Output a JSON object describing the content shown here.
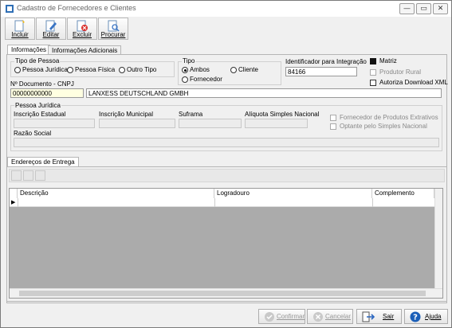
{
  "window": {
    "title": "Cadastro de Fornecedores e Clientes",
    "min": "—",
    "max": "▭",
    "close": "✕"
  },
  "toolbar": [
    {
      "label": "Incluir",
      "icon": "new-document-icon"
    },
    {
      "label": "Editar",
      "icon": "edit-icon"
    },
    {
      "label": "Excluir",
      "icon": "delete-icon"
    },
    {
      "label": "Procurar",
      "icon": "search-document-icon"
    }
  ],
  "tabs": {
    "info": "Informações",
    "extra": "Informações Adicionais"
  },
  "tipo_pessoa": {
    "label": "Tipo de Pessoa",
    "options": [
      "Pessoa Jurídica",
      "Pessoa Física",
      "Outro Tipo"
    ]
  },
  "tipo": {
    "label": "Tipo",
    "options": [
      "Ambos",
      "Cliente",
      "Fornecedor"
    ],
    "selected": "Ambos"
  },
  "integracao": {
    "label": "Identificador para Integração",
    "value": "84166"
  },
  "checks": {
    "matriz": "Matriz",
    "produtor": "Produtor Rural",
    "autoriza": "Autoriza Download XML"
  },
  "documento": {
    "label": "Nº Documento - CNPJ",
    "value": "00000000000",
    "name": "LANXESS DEUTSCHLAND GMBH"
  },
  "pj": {
    "label": "Pessoa Jurídica",
    "ie": "Inscrição Estadual",
    "im": "Inscrição Municipal",
    "suframa": "Suframa",
    "aliquota": "Alíquota Simples Nacional",
    "extrativos": "Fornecedor de Produtos Extrativos",
    "simples": "Optante pelo Simples Nacional",
    "razao": "Razão Social"
  },
  "enderecos": {
    "tab": "Endereços de Entrega",
    "columns": [
      "Descrição",
      "Logradouro",
      "Complemento"
    ],
    "row_marker": "▶"
  },
  "buttons": {
    "confirmar": "Confirmar",
    "cancelar": "Cancelar",
    "sair": "Sair",
    "ajuda": "Ajuda"
  }
}
